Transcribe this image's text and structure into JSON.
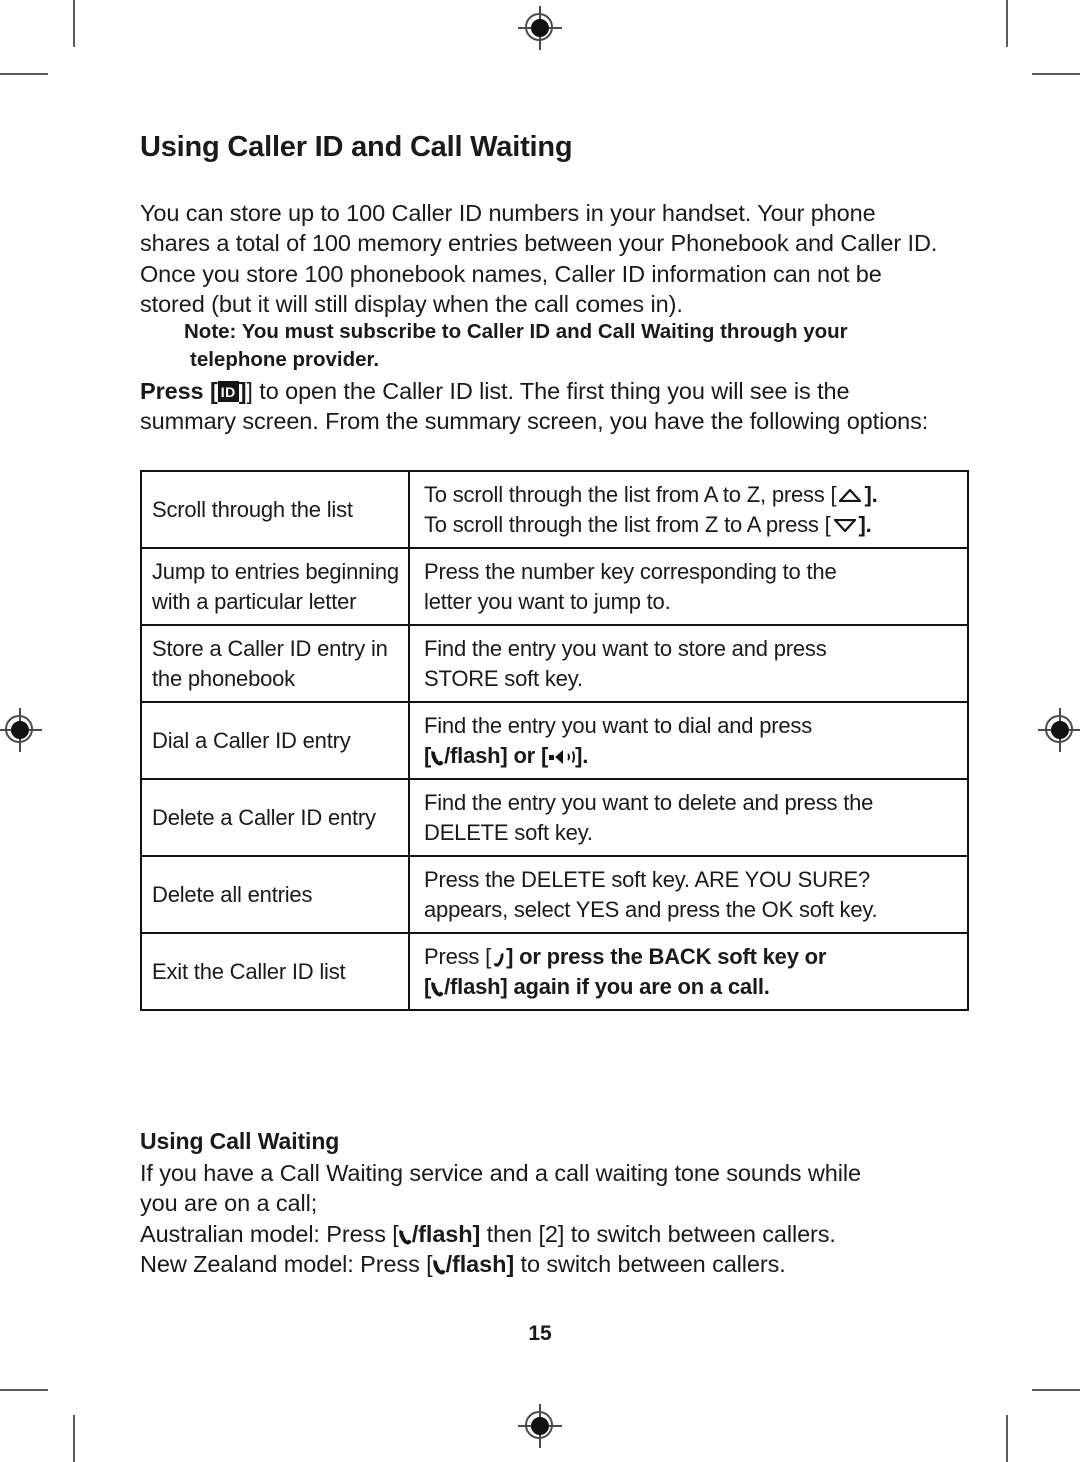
{
  "page": {
    "number": "15",
    "title": "Using Caller ID and Call Waiting"
  },
  "intro": {
    "text": "You can store up to 100 Caller ID numbers in your handset. Your phone shares a total of 100 memory entries between your Phonebook and Caller ID. Once you store 100 phonebook names, Caller ID information can not be stored (but it will still display when the call comes in)."
  },
  "note": {
    "line1": "Note: You must subscribe to Caller ID and Call Waiting through your",
    "line2": "telephone provider."
  },
  "press_para": {
    "before": "Press [",
    "icon_label": "ID",
    "after": "] to open the Caller ID list. The first thing you will see is the summary screen. From the summary screen, you have the following options:"
  },
  "table": {
    "rows": [
      {
        "action": "Scroll through the list",
        "line1_a": "To scroll through the list from A to Z, press [",
        "line1_b": "].",
        "line2_a": "To scroll through the list from Z to A press [",
        "line2_b": "].",
        "icon1": "triangle-up-icon",
        "icon2": "triangle-down-icon"
      },
      {
        "action": "Jump to entries beginning with a particular letter",
        "line1": "Press the number key corresponding to the",
        "line2": "letter you want to jump to."
      },
      {
        "action": "Store a Caller ID entry in the phonebook",
        "line1": "Find the entry you want to store and press",
        "line2": "STORE soft key."
      },
      {
        "action": "Dial a Caller ID entry",
        "line1": "Find the entry you want to dial and press",
        "line2_a": "[",
        "line2_b": "/flash] or [",
        "line2_c": "].",
        "icon_handset": "phone-handset-icon",
        "icon_speaker": "speakerphone-icon"
      },
      {
        "action": "Delete a Caller ID entry",
        "line1": "Find the entry you want to delete and press the",
        "line2": "DELETE soft key."
      },
      {
        "action": "Delete all entries",
        "line1": "Press the DELETE soft key. ARE YOU SURE?",
        "line2": "appears, select YES and press the OK soft key."
      },
      {
        "action": "Exit the Caller ID list",
        "line1_a": "Press [",
        "line1_b": "] or press the BACK soft key or",
        "line2_a": "[",
        "line2_b": "/flash] again if you are on a call.",
        "icon_endcall": "end-call-icon",
        "icon_handset": "phone-handset-icon"
      }
    ]
  },
  "call_waiting": {
    "heading": "Using Call Waiting",
    "line1": "If you have a Call Waiting service and a call waiting tone sounds while",
    "line2": "you are on a call;",
    "au_prefix": "Australian model: Press [",
    "au_flash": "/flash]",
    "au_suffix": " then [2] to switch between callers.",
    "nz_prefix": "New Zealand model: Press [",
    "nz_flash": "/flash]",
    "nz_suffix": " to switch between callers."
  },
  "print_marks": {
    "target_top": "registration-target",
    "target_left": "registration-target",
    "target_right": "registration-target",
    "target_bottom": "registration-target"
  }
}
